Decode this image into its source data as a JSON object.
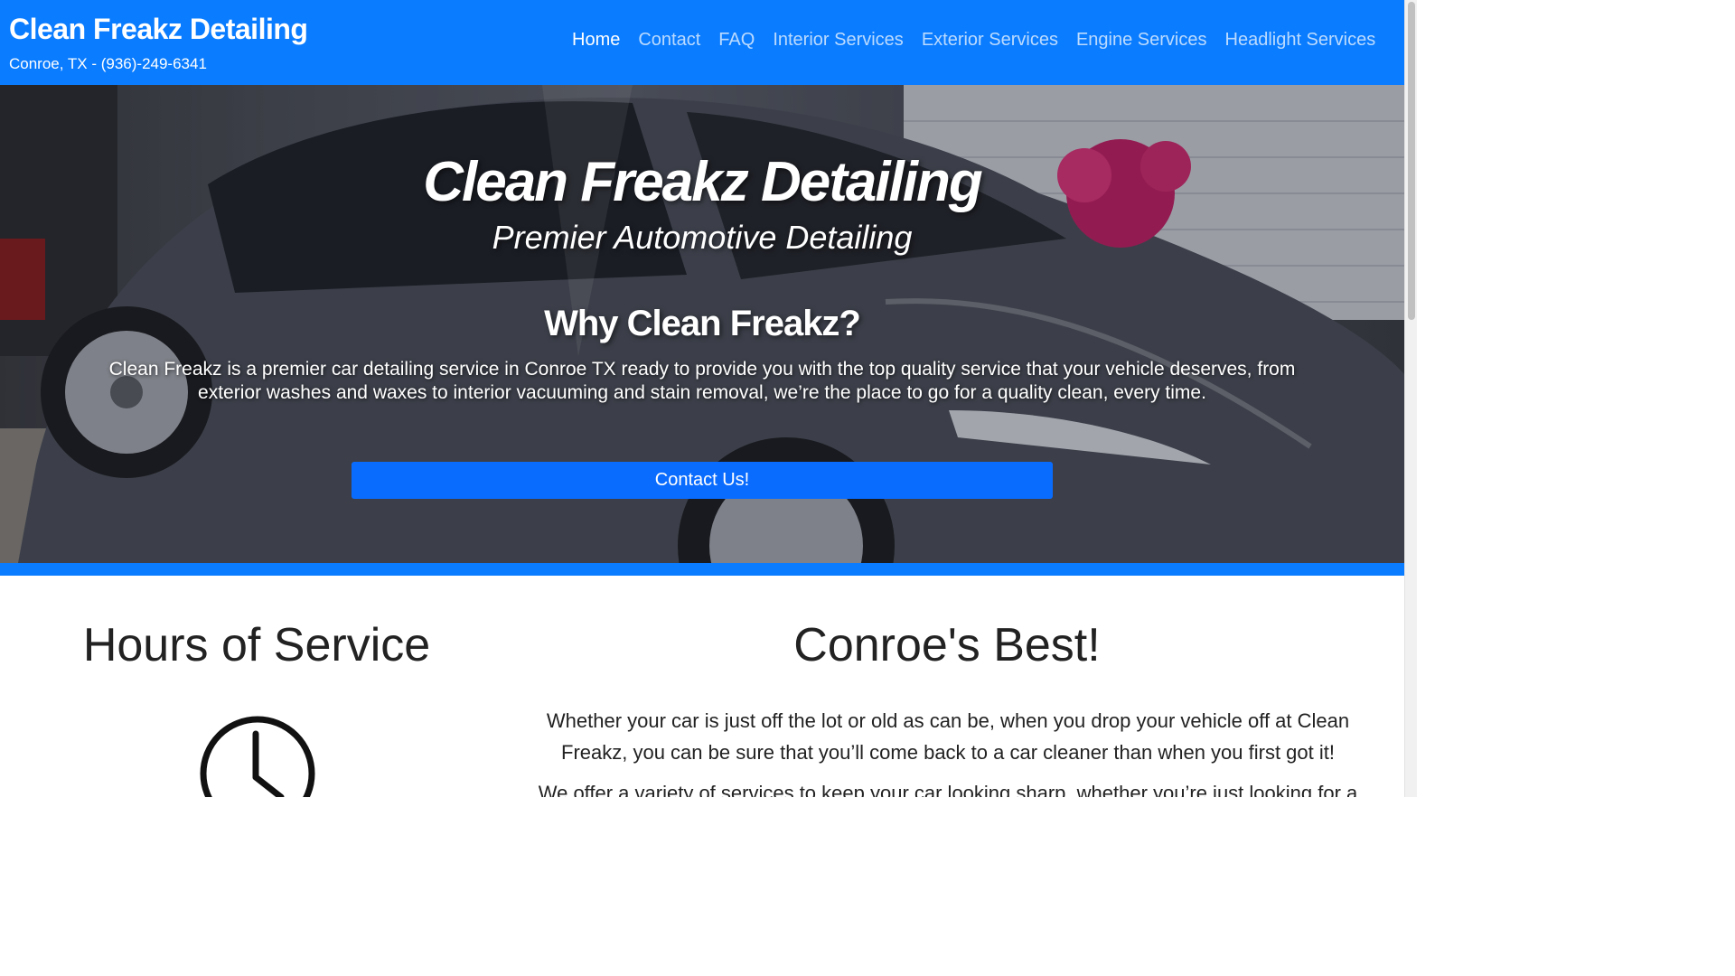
{
  "header": {
    "brand_title": "Clean Freakz Detailing",
    "brand_subtitle": "Conroe, TX - (936)-249-6341",
    "nav": [
      {
        "label": "Home",
        "active": true
      },
      {
        "label": "Contact",
        "active": false
      },
      {
        "label": "FAQ",
        "active": false
      },
      {
        "label": "Interior Services",
        "active": false
      },
      {
        "label": "Exterior Services",
        "active": false
      },
      {
        "label": "Engine Services",
        "active": false
      },
      {
        "label": "Headlight Services",
        "active": false
      }
    ]
  },
  "hero": {
    "title": "Clean Freakz Detailing",
    "subtitle": "Premier Automotive Detailing",
    "why_heading": "Why Clean Freakz?",
    "body": "Clean Freakz is a premier car detailing service in Conroe TX ready to provide you with the top quality service that your vehicle deserves, from exterior washes and waxes to interior vacuuming and stain removal, we’re the place to go for a quality clean, every time.",
    "cta_label": "Contact Us!"
  },
  "hours": {
    "title": "Hours of Service",
    "icon": "clock-icon"
  },
  "best": {
    "title": "Conroe's Best!",
    "paragraph1": "Whether your car is just off the lot or old as can be, when you drop your vehicle off at Clean Freakz, you can be sure that you’ll come back to a car cleaner than when you first got it!",
    "paragraph2": "We offer a variety of services to keep your car looking sharp, whether you’re just looking for a"
  },
  "colors": {
    "brand_blue": "#0a7cff",
    "cta_blue": "#0a6cff",
    "text_dark": "#222222"
  }
}
